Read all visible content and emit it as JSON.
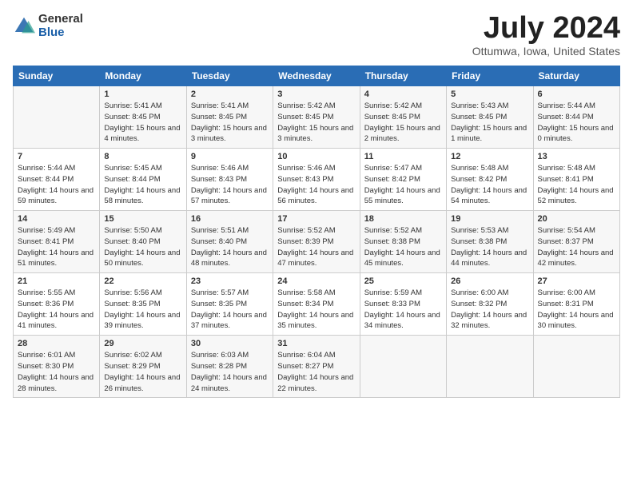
{
  "logo": {
    "general": "General",
    "blue": "Blue"
  },
  "title": {
    "month_year": "July 2024",
    "location": "Ottumwa, Iowa, United States"
  },
  "days_of_week": [
    "Sunday",
    "Monday",
    "Tuesday",
    "Wednesday",
    "Thursday",
    "Friday",
    "Saturday"
  ],
  "weeks": [
    [
      {
        "day": "",
        "info": ""
      },
      {
        "day": "1",
        "sunrise": "5:41 AM",
        "sunset": "8:45 PM",
        "daylight": "15 hours and 4 minutes."
      },
      {
        "day": "2",
        "sunrise": "5:41 AM",
        "sunset": "8:45 PM",
        "daylight": "15 hours and 3 minutes."
      },
      {
        "day": "3",
        "sunrise": "5:42 AM",
        "sunset": "8:45 PM",
        "daylight": "15 hours and 3 minutes."
      },
      {
        "day": "4",
        "sunrise": "5:42 AM",
        "sunset": "8:45 PM",
        "daylight": "15 hours and 2 minutes."
      },
      {
        "day": "5",
        "sunrise": "5:43 AM",
        "sunset": "8:45 PM",
        "daylight": "15 hours and 1 minute."
      },
      {
        "day": "6",
        "sunrise": "5:44 AM",
        "sunset": "8:44 PM",
        "daylight": "15 hours and 0 minutes."
      }
    ],
    [
      {
        "day": "7",
        "sunrise": "5:44 AM",
        "sunset": "8:44 PM",
        "daylight": "14 hours and 59 minutes."
      },
      {
        "day": "8",
        "sunrise": "5:45 AM",
        "sunset": "8:44 PM",
        "daylight": "14 hours and 58 minutes."
      },
      {
        "day": "9",
        "sunrise": "5:46 AM",
        "sunset": "8:43 PM",
        "daylight": "14 hours and 57 minutes."
      },
      {
        "day": "10",
        "sunrise": "5:46 AM",
        "sunset": "8:43 PM",
        "daylight": "14 hours and 56 minutes."
      },
      {
        "day": "11",
        "sunrise": "5:47 AM",
        "sunset": "8:42 PM",
        "daylight": "14 hours and 55 minutes."
      },
      {
        "day": "12",
        "sunrise": "5:48 AM",
        "sunset": "8:42 PM",
        "daylight": "14 hours and 54 minutes."
      },
      {
        "day": "13",
        "sunrise": "5:48 AM",
        "sunset": "8:41 PM",
        "daylight": "14 hours and 52 minutes."
      }
    ],
    [
      {
        "day": "14",
        "sunrise": "5:49 AM",
        "sunset": "8:41 PM",
        "daylight": "14 hours and 51 minutes."
      },
      {
        "day": "15",
        "sunrise": "5:50 AM",
        "sunset": "8:40 PM",
        "daylight": "14 hours and 50 minutes."
      },
      {
        "day": "16",
        "sunrise": "5:51 AM",
        "sunset": "8:40 PM",
        "daylight": "14 hours and 48 minutes."
      },
      {
        "day": "17",
        "sunrise": "5:52 AM",
        "sunset": "8:39 PM",
        "daylight": "14 hours and 47 minutes."
      },
      {
        "day": "18",
        "sunrise": "5:52 AM",
        "sunset": "8:38 PM",
        "daylight": "14 hours and 45 minutes."
      },
      {
        "day": "19",
        "sunrise": "5:53 AM",
        "sunset": "8:38 PM",
        "daylight": "14 hours and 44 minutes."
      },
      {
        "day": "20",
        "sunrise": "5:54 AM",
        "sunset": "8:37 PM",
        "daylight": "14 hours and 42 minutes."
      }
    ],
    [
      {
        "day": "21",
        "sunrise": "5:55 AM",
        "sunset": "8:36 PM",
        "daylight": "14 hours and 41 minutes."
      },
      {
        "day": "22",
        "sunrise": "5:56 AM",
        "sunset": "8:35 PM",
        "daylight": "14 hours and 39 minutes."
      },
      {
        "day": "23",
        "sunrise": "5:57 AM",
        "sunset": "8:35 PM",
        "daylight": "14 hours and 37 minutes."
      },
      {
        "day": "24",
        "sunrise": "5:58 AM",
        "sunset": "8:34 PM",
        "daylight": "14 hours and 35 minutes."
      },
      {
        "day": "25",
        "sunrise": "5:59 AM",
        "sunset": "8:33 PM",
        "daylight": "14 hours and 34 minutes."
      },
      {
        "day": "26",
        "sunrise": "6:00 AM",
        "sunset": "8:32 PM",
        "daylight": "14 hours and 32 minutes."
      },
      {
        "day": "27",
        "sunrise": "6:00 AM",
        "sunset": "8:31 PM",
        "daylight": "14 hours and 30 minutes."
      }
    ],
    [
      {
        "day": "28",
        "sunrise": "6:01 AM",
        "sunset": "8:30 PM",
        "daylight": "14 hours and 28 minutes."
      },
      {
        "day": "29",
        "sunrise": "6:02 AM",
        "sunset": "8:29 PM",
        "daylight": "14 hours and 26 minutes."
      },
      {
        "day": "30",
        "sunrise": "6:03 AM",
        "sunset": "8:28 PM",
        "daylight": "14 hours and 24 minutes."
      },
      {
        "day": "31",
        "sunrise": "6:04 AM",
        "sunset": "8:27 PM",
        "daylight": "14 hours and 22 minutes."
      },
      {
        "day": "",
        "info": ""
      },
      {
        "day": "",
        "info": ""
      },
      {
        "day": "",
        "info": ""
      }
    ]
  ],
  "labels": {
    "sunrise_prefix": "Sunrise:",
    "sunset_prefix": "Sunset:",
    "daylight_prefix": "Daylight:"
  }
}
